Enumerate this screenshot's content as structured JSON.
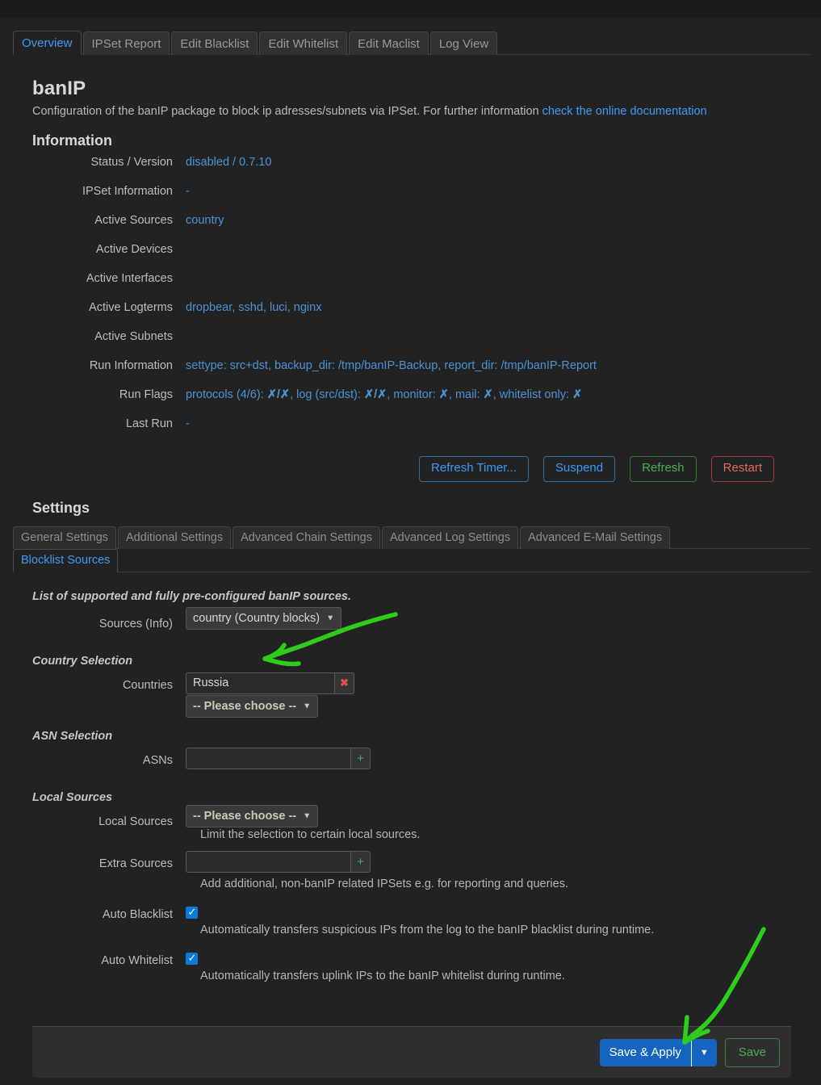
{
  "top_tabs": [
    {
      "label": "Overview",
      "active": true
    },
    {
      "label": "IPSet Report",
      "active": false
    },
    {
      "label": "Edit Blacklist",
      "active": false
    },
    {
      "label": "Edit Whitelist",
      "active": false
    },
    {
      "label": "Edit Maclist",
      "active": false
    },
    {
      "label": "Log View",
      "active": false
    }
  ],
  "page": {
    "title": "banIP",
    "description": "Configuration of the banIP package to block ip adresses/subnets via IPSet. For further information ",
    "doc_link": "check the online documentation"
  },
  "information": {
    "heading": "Information",
    "rows": [
      {
        "label": "Status / Version",
        "value": "disabled / 0.7.10"
      },
      {
        "label": "IPSet Information",
        "value": "-"
      },
      {
        "label": "Active Sources",
        "value": "country"
      },
      {
        "label": "Active Devices",
        "value": ""
      },
      {
        "label": "Active Interfaces",
        "value": ""
      },
      {
        "label": "Active Logterms",
        "value": "dropbear, sshd, luci, nginx"
      },
      {
        "label": "Active Subnets",
        "value": ""
      },
      {
        "label": "Run Information",
        "value": "settype: src+dst, backup_dir: /tmp/banIP-Backup, report_dir: /tmp/banIP-Report"
      },
      {
        "label": "Run Flags",
        "value": ""
      },
      {
        "label": "Last Run",
        "value": "-"
      }
    ],
    "run_flags": {
      "protocols_label": "protocols (4/6): ",
      "protocols_value": "✗/✗",
      "log_label": ", log (src/dst): ",
      "log_value": "✗/✗",
      "monitor_label": ", monitor: ",
      "monitor_value": "✗",
      "mail_label": ", mail: ",
      "mail_value": "✗",
      "whitelist_label": ", whitelist only: ",
      "whitelist_value": "✗"
    }
  },
  "actions": {
    "refresh_timer": "Refresh Timer...",
    "suspend": "Suspend",
    "refresh": "Refresh",
    "restart": "Restart"
  },
  "settings": {
    "heading": "Settings",
    "tabs_row1": [
      {
        "label": "General Settings",
        "active": false
      },
      {
        "label": "Additional Settings",
        "active": false
      },
      {
        "label": "Advanced Chain Settings",
        "active": false
      },
      {
        "label": "Advanced Log Settings",
        "active": false
      },
      {
        "label": "Advanced E-Mail Settings",
        "active": false
      }
    ],
    "tabs_row2": [
      {
        "label": "Blocklist Sources",
        "active": true
      }
    ],
    "intro": "List of supported and fully pre-configured banIP sources.",
    "sources": {
      "label": "Sources (Info)",
      "value": "country (Country blocks)"
    },
    "country_selection": {
      "heading": "Country Selection",
      "label": "Countries",
      "value": "Russia",
      "remove_icon": "✖",
      "chooser": "-- Please choose --"
    },
    "asn_selection": {
      "heading": "ASN Selection",
      "label": "ASNs",
      "value": "",
      "add_icon": "+"
    },
    "local_sources": {
      "heading": "Local Sources",
      "label": "Local Sources",
      "value": "-- Please choose --",
      "help": "Limit the selection to certain local sources."
    },
    "extra_sources": {
      "label": "Extra Sources",
      "value": "",
      "add_icon": "+",
      "help": "Add additional, non-banIP related IPSets e.g. for reporting and queries."
    },
    "auto_blacklist": {
      "label": "Auto Blacklist",
      "checked": true,
      "help": "Automatically transfers suspicious IPs from the log to the banIP blacklist during runtime."
    },
    "auto_whitelist": {
      "label": "Auto Whitelist",
      "checked": true,
      "help": "Automatically transfers uplink IPs to the banIP whitelist during runtime."
    }
  },
  "footer": {
    "save_apply": "Save & Apply",
    "caret": "▼",
    "save": "Save"
  },
  "colors": {
    "accent_blue": "#3d9bf5",
    "link_blue": "#4a93d6",
    "green": "#4caf50",
    "red": "#d9534f",
    "annotation_green": "#2ecc1b",
    "apply_blue": "#1565c0"
  }
}
